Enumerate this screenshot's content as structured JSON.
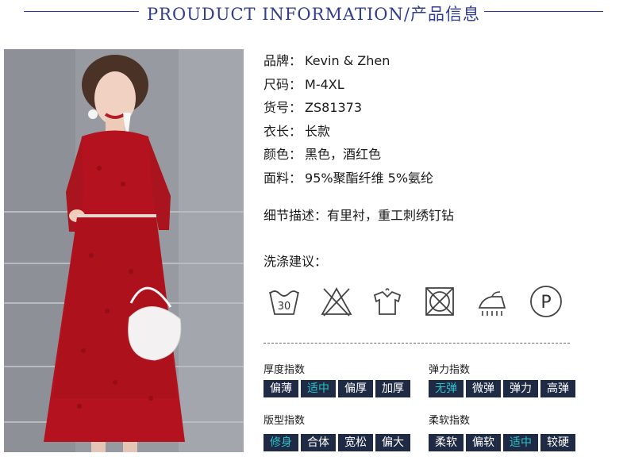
{
  "header": {
    "title": "PROUDUCT INFORMATION/产品信息"
  },
  "info": [
    {
      "k": "品牌：",
      "v": "Kevin & Zhen"
    },
    {
      "k": "尺码：",
      "v": "M-4XL"
    },
    {
      "k": "货号：",
      "v": "ZS81373"
    },
    {
      "k": "衣长：",
      "v": "长款"
    },
    {
      "k": "颜色：",
      "v": "黑色，酒红色"
    },
    {
      "k": "面料：",
      "v": "95%聚酯纤维 5%氨纶"
    }
  ],
  "detail": "细节描述：有里衬，重工刺绣钉钻",
  "wash_title": "洗涤建议：",
  "care": {
    "wash_temp": "30",
    "icons": [
      "wash-30-icon",
      "no-bleach-icon",
      "hang-dry-icon",
      "no-tumble-dry-icon",
      "iron-steam-icon",
      "dry-clean-p-icon"
    ],
    "dry_clean_letter": "P"
  },
  "indices": {
    "thickness": {
      "title": "厚度指数",
      "options": [
        "偏薄",
        "适中",
        "偏厚",
        "加厚"
      ],
      "selected": "适中"
    },
    "elasticity": {
      "title": "弹力指数",
      "options": [
        "无弹",
        "微弹",
        "弹力",
        "高弹"
      ],
      "selected": "无弹"
    },
    "fit": {
      "title": "版型指数",
      "options": [
        "修身",
        "合体",
        "宽松",
        "偏大"
      ],
      "selected": "修身"
    },
    "softness": {
      "title": "柔软指数",
      "options": [
        "柔软",
        "偏软",
        "适中",
        "较硬"
      ],
      "selected": "适中"
    }
  },
  "colors": {
    "header": "#2f3c8f",
    "chip_bg": "#1f2a44",
    "chip_selected_text": "#29c2c9",
    "dress": "#b3121e"
  }
}
